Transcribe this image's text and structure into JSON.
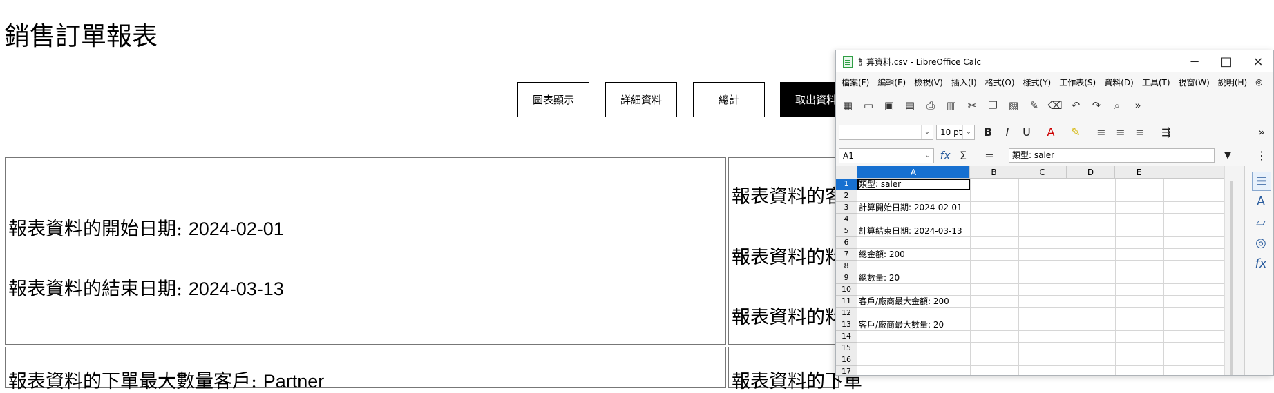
{
  "page": {
    "title": "銷售訂單報表",
    "buttons": [
      "圖表顯示",
      "詳細資料",
      "總計",
      "取出資料"
    ],
    "cells": [
      [
        {
          "label": "報表資料的開始日期: ",
          "value": "2024-02-01"
        },
        {
          "label": "報表資料的結束日期: ",
          "value": "2024-03-13"
        }
      ],
      [
        {
          "label": "報表資料的客戶",
          "value": ""
        },
        {
          "label": "報表資料的料品",
          "value": ""
        },
        {
          "label": "報表資料的料品",
          "value": ""
        }
      ],
      [
        {
          "label": "報表資料的下單最大數量客戶: ",
          "value": "Partner"
        }
      ],
      [
        {
          "label": "報表資料的下單",
          "value": ""
        }
      ]
    ]
  },
  "window": {
    "title": "計算資料.csv - LibreOffice Calc",
    "menu": [
      "檔案(F)",
      "編輯(E)",
      "檢視(V)",
      "插入(I)",
      "格式(O)",
      "樣式(Y)",
      "工作表(S)",
      "資料(D)",
      "工具(T)",
      "視窗(W)",
      "說明(H)"
    ],
    "font_size": "10 pt",
    "name_box": "A1",
    "formula_value": "類型: saler",
    "columns": [
      "A",
      "B",
      "C",
      "D",
      "E"
    ],
    "rows": [
      "1",
      "2",
      "3",
      "4",
      "5",
      "6",
      "7",
      "8",
      "9",
      "10",
      "11",
      "12",
      "13",
      "14",
      "15",
      "16",
      "17"
    ],
    "cells": {
      "1": "類型: saler",
      "3": "計算開始日期: 2024-02-01",
      "5": "計算結束日期: 2024-03-13",
      "7": "總金額: 200",
      "9": "總數量: 20",
      "11": "客戶/廠商最大金額: 200",
      "13": "客戶/廠商最大數量: 20"
    }
  }
}
